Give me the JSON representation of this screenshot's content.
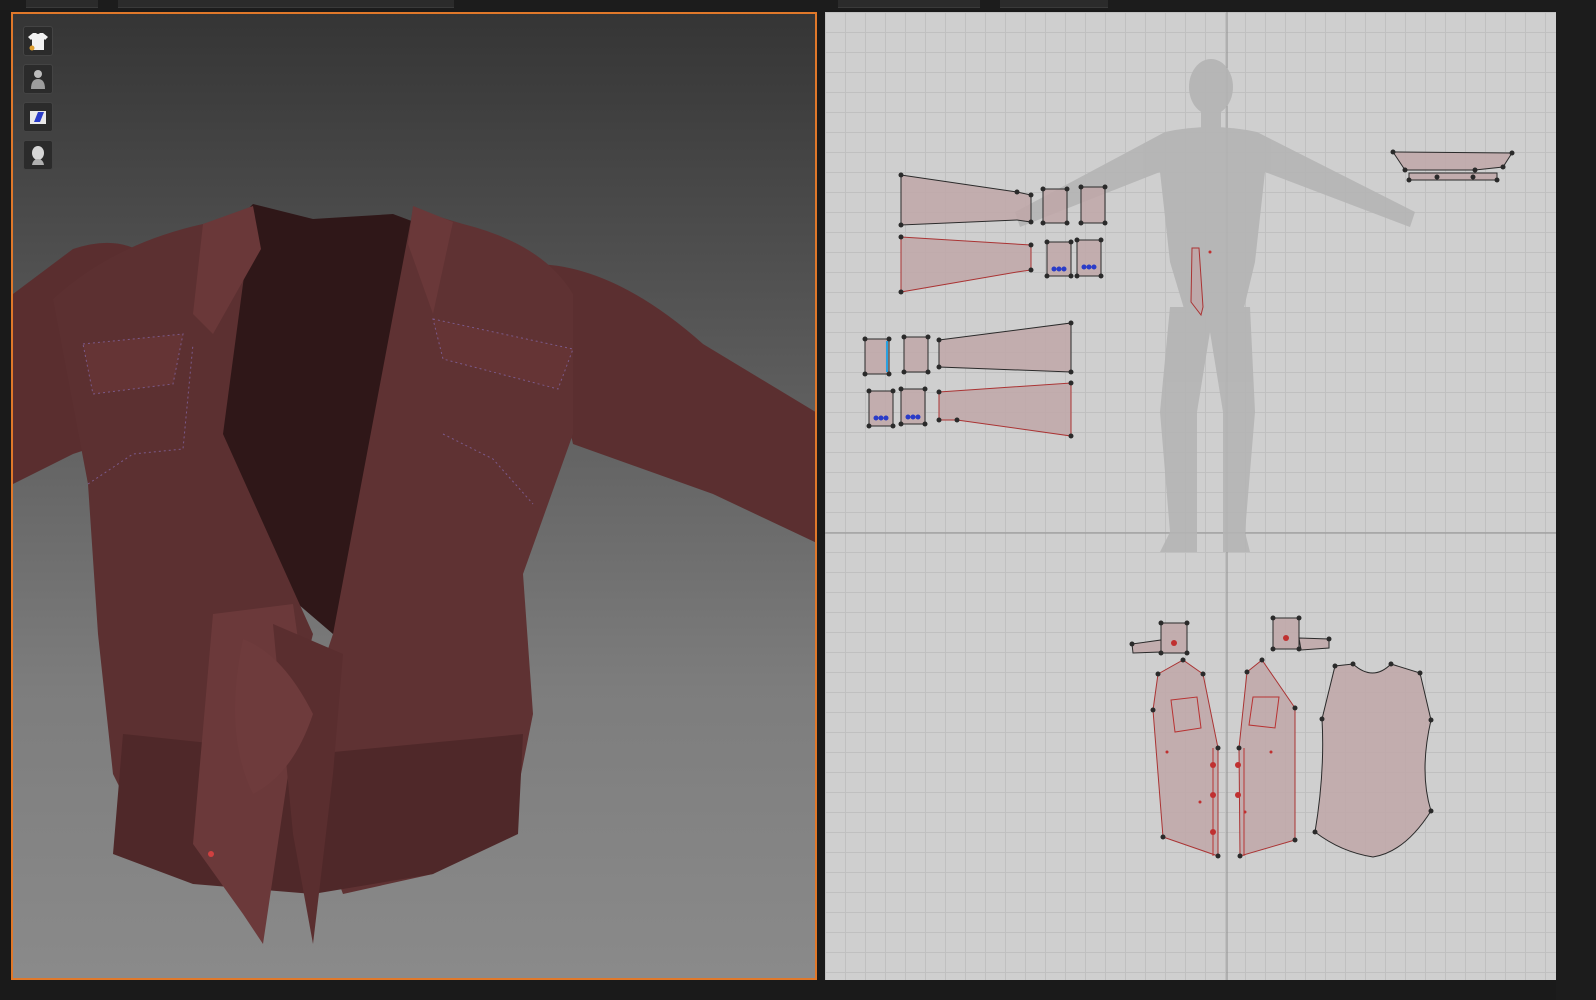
{
  "app": {
    "accent_color": "#e0782a",
    "garment_color": "#5a2e2f",
    "pattern_fill": "#bfa7a8"
  },
  "viewport_3d": {
    "toolbar": [
      {
        "name": "garment-display-icon"
      },
      {
        "name": "avatar-display-icon"
      },
      {
        "name": "fabric-render-icon"
      },
      {
        "name": "avatar-head-icon"
      }
    ]
  },
  "pattern_window": {
    "grid": true,
    "avatar_silhouette": true
  }
}
